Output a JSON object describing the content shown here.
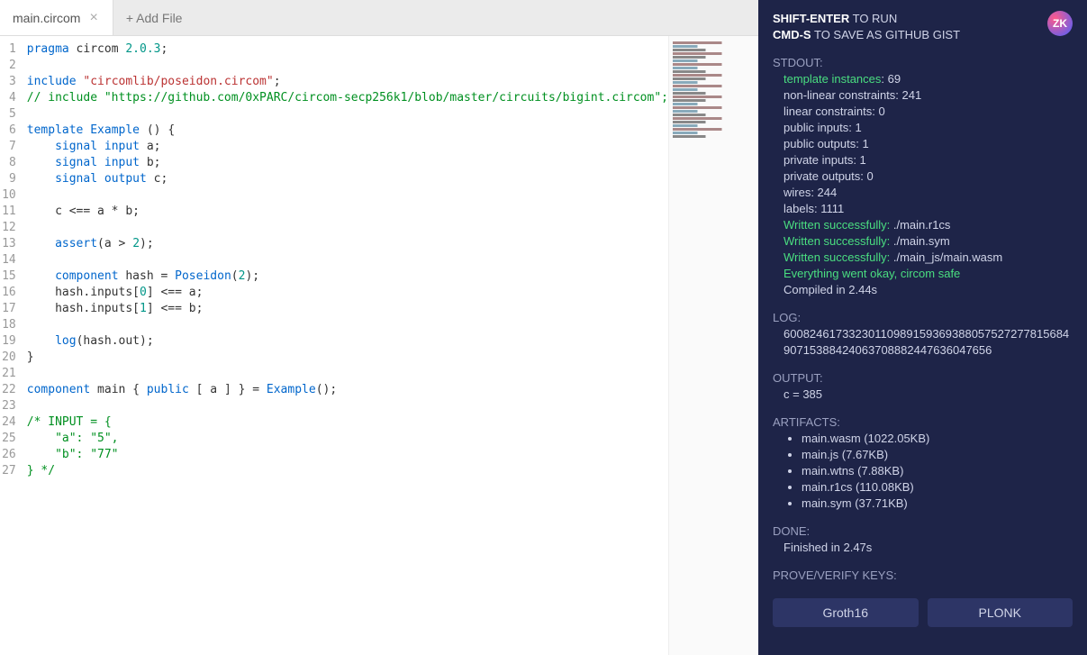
{
  "tabs": {
    "active": "main.circom",
    "add_label": "+ Add File"
  },
  "code": {
    "lines": [
      [
        {
          "t": "kw",
          "v": "pragma"
        },
        {
          "t": "plain",
          "v": " circom "
        },
        {
          "t": "num",
          "v": "2.0.3"
        },
        {
          "t": "plain",
          "v": ";"
        }
      ],
      [],
      [
        {
          "t": "kw",
          "v": "include"
        },
        {
          "t": "plain",
          "v": " "
        },
        {
          "t": "str",
          "v": "\"circomlib/poseidon.circom\""
        },
        {
          "t": "plain",
          "v": ";"
        }
      ],
      [
        {
          "t": "cm",
          "v": "// include \"https://github.com/0xPARC/circom-secp256k1/blob/master/circuits/bigint.circom\";"
        }
      ],
      [],
      [
        {
          "t": "kw",
          "v": "template"
        },
        {
          "t": "plain",
          "v": " "
        },
        {
          "t": "type",
          "v": "Example"
        },
        {
          "t": "plain",
          "v": " () {"
        }
      ],
      [
        {
          "t": "plain",
          "v": "    "
        },
        {
          "t": "kw",
          "v": "signal"
        },
        {
          "t": "plain",
          "v": " "
        },
        {
          "t": "kw",
          "v": "input"
        },
        {
          "t": "plain",
          "v": " a;"
        }
      ],
      [
        {
          "t": "plain",
          "v": "    "
        },
        {
          "t": "kw",
          "v": "signal"
        },
        {
          "t": "plain",
          "v": " "
        },
        {
          "t": "kw",
          "v": "input"
        },
        {
          "t": "plain",
          "v": " b;"
        }
      ],
      [
        {
          "t": "plain",
          "v": "    "
        },
        {
          "t": "kw",
          "v": "signal"
        },
        {
          "t": "plain",
          "v": " "
        },
        {
          "t": "kw",
          "v": "output"
        },
        {
          "t": "plain",
          "v": " c;"
        }
      ],
      [],
      [
        {
          "t": "plain",
          "v": "    c <== a * b;"
        }
      ],
      [],
      [
        {
          "t": "plain",
          "v": "    "
        },
        {
          "t": "fn",
          "v": "assert"
        },
        {
          "t": "plain",
          "v": "(a > "
        },
        {
          "t": "num",
          "v": "2"
        },
        {
          "t": "plain",
          "v": ");"
        }
      ],
      [],
      [
        {
          "t": "plain",
          "v": "    "
        },
        {
          "t": "kw",
          "v": "component"
        },
        {
          "t": "plain",
          "v": " hash = "
        },
        {
          "t": "type",
          "v": "Poseidon"
        },
        {
          "t": "plain",
          "v": "("
        },
        {
          "t": "num",
          "v": "2"
        },
        {
          "t": "plain",
          "v": ");"
        }
      ],
      [
        {
          "t": "plain",
          "v": "    hash.inputs["
        },
        {
          "t": "num",
          "v": "0"
        },
        {
          "t": "plain",
          "v": "] <== a;"
        }
      ],
      [
        {
          "t": "plain",
          "v": "    hash.inputs["
        },
        {
          "t": "num",
          "v": "1"
        },
        {
          "t": "plain",
          "v": "] <== b;"
        }
      ],
      [],
      [
        {
          "t": "plain",
          "v": "    "
        },
        {
          "t": "fn",
          "v": "log"
        },
        {
          "t": "plain",
          "v": "(hash.out);"
        }
      ],
      [
        {
          "t": "plain",
          "v": "}"
        }
      ],
      [],
      [
        {
          "t": "kw",
          "v": "component"
        },
        {
          "t": "plain",
          "v": " main { "
        },
        {
          "t": "kw",
          "v": "public"
        },
        {
          "t": "plain",
          "v": " [ a ] } = "
        },
        {
          "t": "type",
          "v": "Example"
        },
        {
          "t": "plain",
          "v": "();"
        }
      ],
      [],
      [
        {
          "t": "cm",
          "v": "/* INPUT = {"
        }
      ],
      [
        {
          "t": "cm",
          "v": "    \"a\": \"5\","
        }
      ],
      [
        {
          "t": "cm",
          "v": "    \"b\": \"77\""
        }
      ],
      [
        {
          "t": "cm",
          "v": "} */"
        }
      ]
    ]
  },
  "header": {
    "run_key": "SHIFT-ENTER",
    "run_text": " TO RUN",
    "save_key": "CMD-S",
    "save_text": " TO SAVE AS GITHUB GIST",
    "logo_text": "ZK"
  },
  "stdout": {
    "label": "STDOUT:",
    "lines": [
      {
        "prefix": "template instances",
        "prefix_green": true,
        "suffix": ": 69"
      },
      {
        "text": "non-linear constraints: 241"
      },
      {
        "text": "linear constraints: 0"
      },
      {
        "text": "public inputs: 1"
      },
      {
        "text": "public outputs: 1"
      },
      {
        "text": "private inputs: 1"
      },
      {
        "text": "private outputs: 0"
      },
      {
        "text": "wires: 244"
      },
      {
        "text": "labels: 1111"
      },
      {
        "prefix": "Written successfully:",
        "prefix_green": true,
        "suffix": " ./main.r1cs"
      },
      {
        "prefix": "Written successfully:",
        "prefix_green": true,
        "suffix": " ./main.sym"
      },
      {
        "prefix": "Written successfully:",
        "prefix_green": true,
        "suffix": " ./main_js/main.wasm"
      },
      {
        "prefix": "Everything went okay, circom safe",
        "prefix_green": true,
        "suffix": ""
      },
      {
        "text": "Compiled in 2.44s"
      }
    ]
  },
  "log": {
    "label": "LOG:",
    "value": "6008246173323011098915936938805752727781568490715388424063708882447636047656"
  },
  "output": {
    "label": "OUTPUT:",
    "value": "c = 385"
  },
  "artifacts": {
    "label": "ARTIFACTS:",
    "items": [
      "main.wasm (1022.05KB)",
      "main.js (7.67KB)",
      "main.wtns (7.88KB)",
      "main.r1cs (110.08KB)",
      "main.sym (37.71KB)"
    ]
  },
  "done": {
    "label": "DONE:",
    "value": "Finished in 2.47s"
  },
  "keys": {
    "label": "PROVE/VERIFY KEYS:",
    "buttons": [
      "Groth16",
      "PLONK"
    ]
  }
}
